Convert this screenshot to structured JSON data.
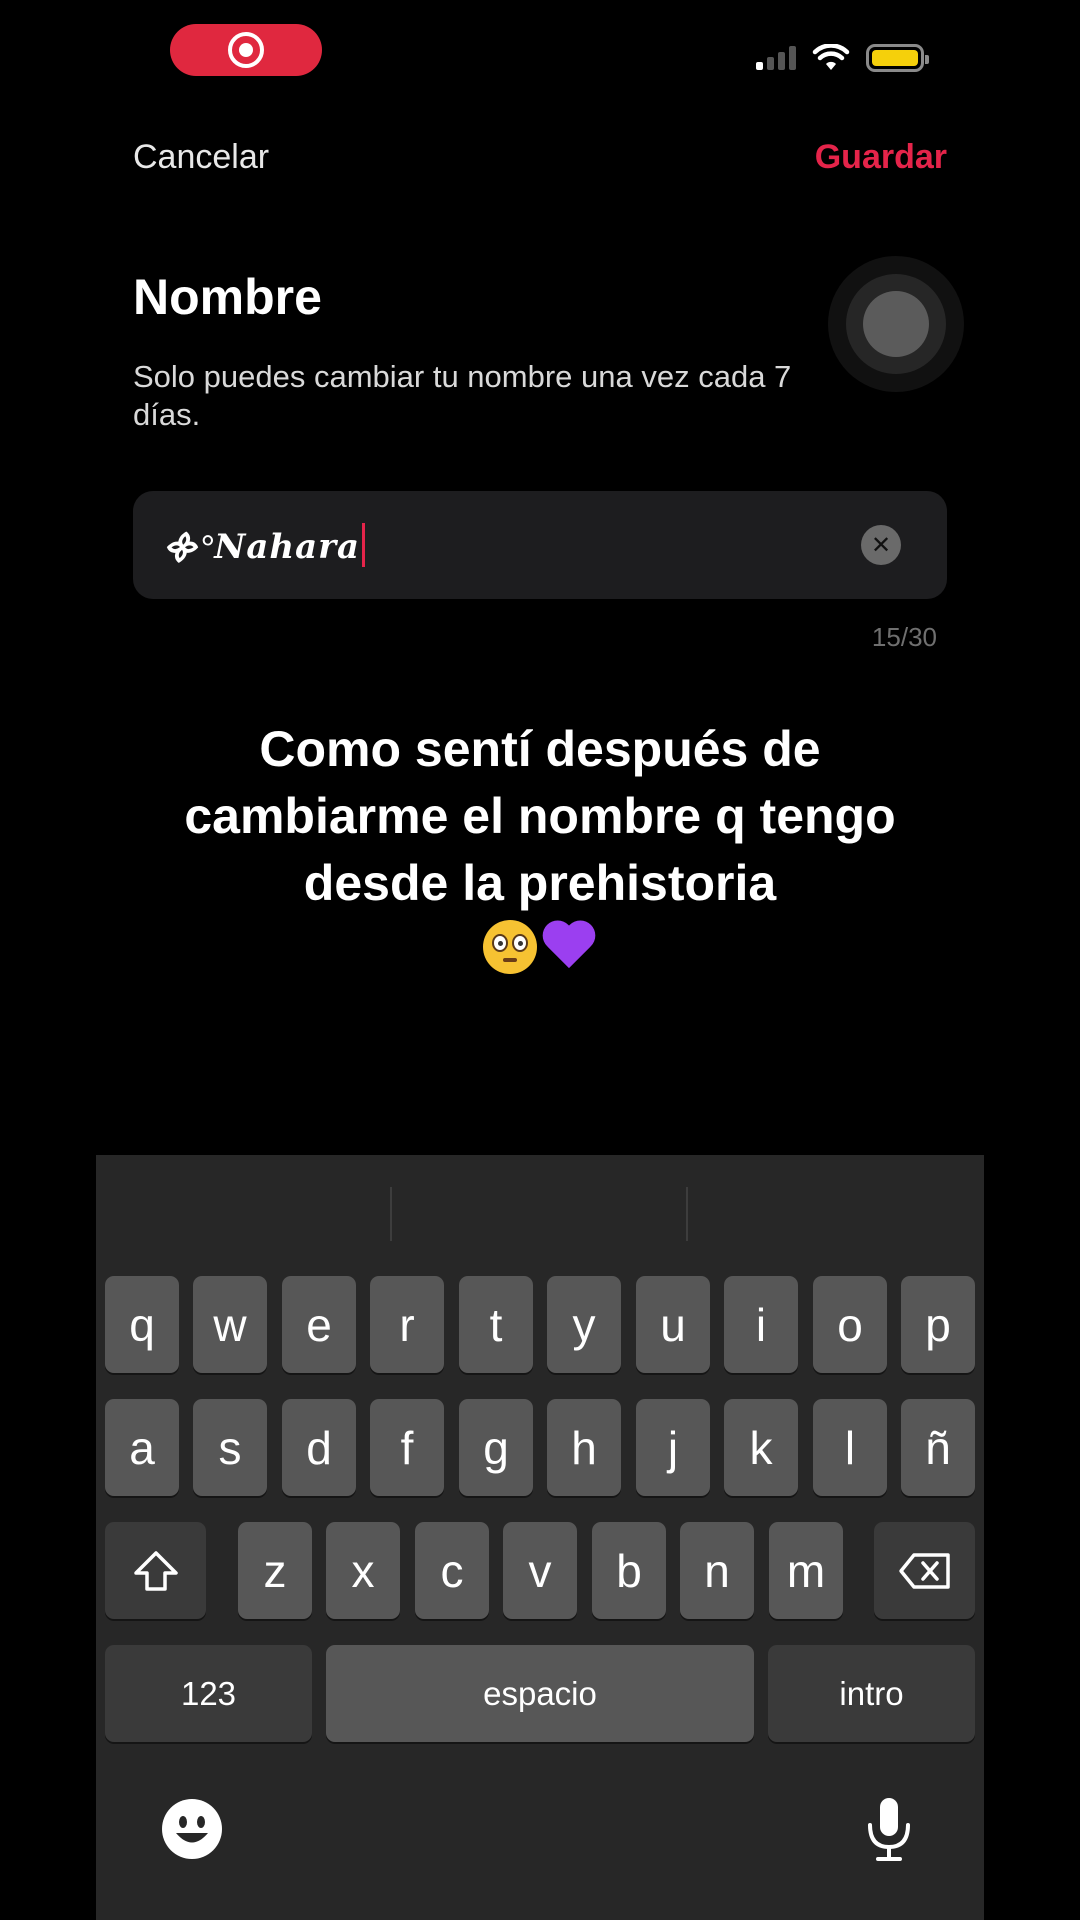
{
  "status_bar": {
    "recording_indicator": "screen-recording",
    "colors": {
      "recording": "#e0283f",
      "battery": "#f5d00b"
    }
  },
  "nav": {
    "cancel_label": "Cancelar",
    "save_label": "Guardar",
    "accent_color": "#e5244a"
  },
  "form": {
    "title": "Nombre",
    "subtitle": "Solo puedes cambiar tu nombre una vez cada 7 días.",
    "name_value": "᯽°𝑵𝒂𝒉𝒂𝒓𝒂",
    "counter": "15/30"
  },
  "overlay": {
    "caption": "Como sentí después de cambiarme el nombre q tengo desde la prehistoria",
    "emojis": [
      "flushed-face",
      "purple-heart"
    ]
  },
  "keyboard": {
    "row1": [
      "q",
      "w",
      "e",
      "r",
      "t",
      "y",
      "u",
      "i",
      "o",
      "p"
    ],
    "row2": [
      "a",
      "s",
      "d",
      "f",
      "g",
      "h",
      "j",
      "k",
      "l",
      "ñ"
    ],
    "row3": [
      "z",
      "x",
      "c",
      "v",
      "b",
      "n",
      "m"
    ],
    "numbers_label": "123",
    "space_label": "espacio",
    "return_label": "intro",
    "icons": [
      "shift-icon",
      "backspace-icon",
      "emoji-icon",
      "microphone-icon"
    ]
  }
}
